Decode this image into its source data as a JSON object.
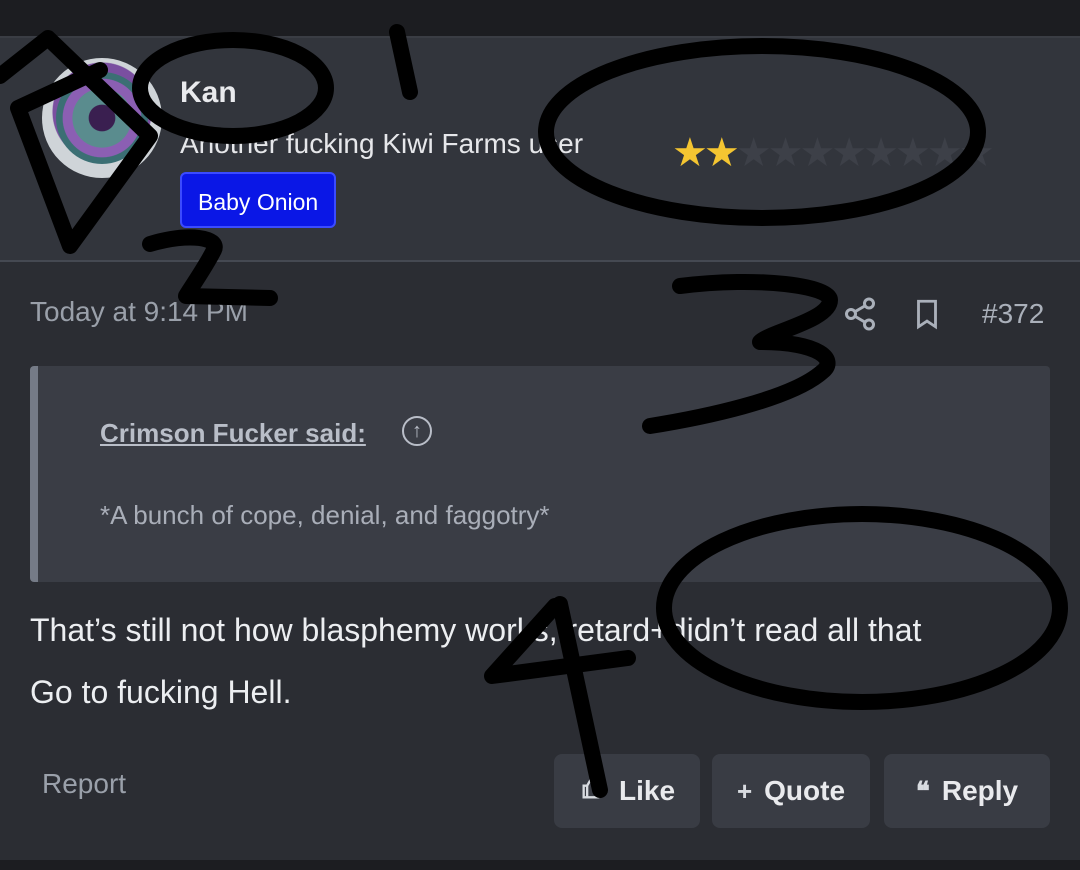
{
  "user": {
    "name": "Kan",
    "title": "Another fucking Kiwi Farms user",
    "badge": "Baby Onion",
    "rating": {
      "filled": 2,
      "total": 10
    }
  },
  "post": {
    "timestamp": "Today at 9:14 PM",
    "number": "#372",
    "quote": {
      "author": "Crimson Fucker said:",
      "text": "*A bunch of cope, denial, and faggotry*"
    },
    "body": {
      "line1": "That’s still not how blasphemy works, retard+didn’t read all that",
      "line2": "Go to fucking Hell."
    }
  },
  "actions": {
    "report": "Report",
    "like": "Like",
    "quote": "Quote",
    "reply": "Reply"
  },
  "annotations": {
    "marks": [
      "1",
      "2",
      "3",
      "4"
    ]
  },
  "icons": [
    "share-icon",
    "bookmark-icon",
    "quote-up-arrow-icon",
    "like-icon",
    "plus-icon",
    "quote-marks-icon"
  ],
  "colors": {
    "badge": "#0a17e6",
    "star": "#f4c531",
    "background": "#2b2d33"
  }
}
